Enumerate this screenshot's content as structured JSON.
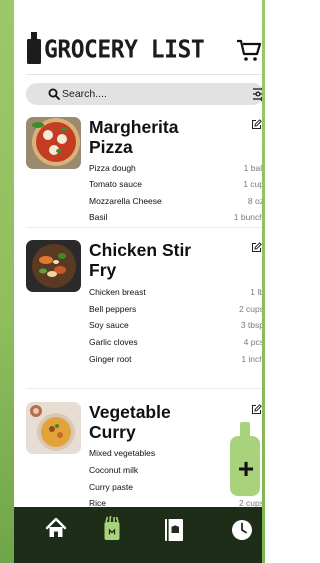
{
  "app": {
    "title": "GROCERY LIST"
  },
  "search": {
    "placeholder": "Search...."
  },
  "colors": {
    "accent": "#a9d27c",
    "nav_bg": "#1d2d17",
    "strip": "#8fbf5d"
  },
  "recipes": [
    {
      "title_line1": "Margherita",
      "title_line2": "Pizza",
      "image_icon": "pizza-photo",
      "ingredients": [
        {
          "name": "Pizza dough",
          "qty": "1 ball"
        },
        {
          "name": "Tomato sauce",
          "qty": "1 cup"
        },
        {
          "name": "Mozzarella Cheese",
          "qty": "8 oz"
        },
        {
          "name": "Basil",
          "qty": "1 bunch"
        }
      ]
    },
    {
      "title_line1": "Chicken Stir",
      "title_line2": "Fry",
      "image_icon": "stir-fry-photo",
      "ingredients": [
        {
          "name": "Chicken breast",
          "qty": "1 lb"
        },
        {
          "name": "Bell peppers",
          "qty": "2 cups"
        },
        {
          "name": "Soy sauce",
          "qty": "3 tbsp"
        },
        {
          "name": "Garlic cloves",
          "qty": "4 pcs"
        },
        {
          "name": "Ginger root",
          "qty": "1 inch"
        }
      ]
    },
    {
      "title_line1": "Vegetable",
      "title_line2": "Curry",
      "image_icon": "curry-photo",
      "ingredients": [
        {
          "name": "Mixed vegetables",
          "qty": ""
        },
        {
          "name": "Coconut milk",
          "qty": ""
        },
        {
          "name": "Curry paste",
          "qty": ""
        },
        {
          "name": "Rice",
          "qty": "2 cups"
        }
      ]
    }
  ],
  "fab": {
    "label": "+"
  },
  "nav": [
    {
      "icon": "home-icon"
    },
    {
      "icon": "grocery-bag-icon"
    },
    {
      "icon": "recipe-book-icon"
    },
    {
      "icon": "clock-icon"
    }
  ]
}
